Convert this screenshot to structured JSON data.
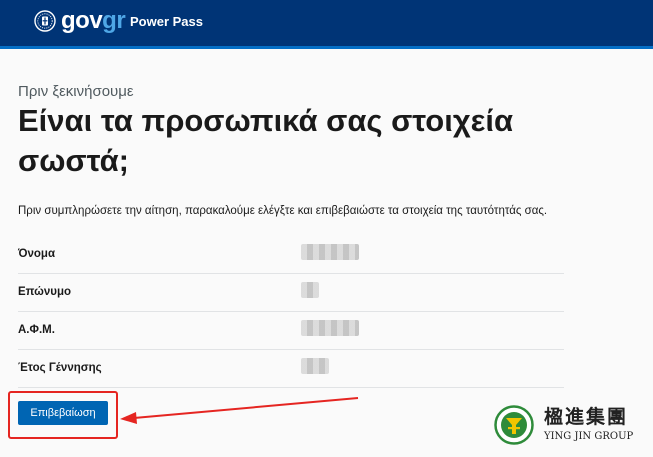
{
  "header": {
    "logo": {
      "gov": "gov",
      "gr": "gr",
      "emblem": "greek-emblem-icon"
    },
    "app_name": "Power Pass"
  },
  "page": {
    "overline": "Πριν ξεκινήσουμε",
    "title": "Είναι τα προσωπικά σας στοιχεία σωστά;",
    "intro": "Πριν συμπληρώσετε την αίτηση, παρακαλούμε ελέγξτε και επιβεβαιώστε τα στοιχεία της ταυτότητάς σας."
  },
  "details": [
    {
      "label": "Όνομα",
      "value_obscured": true
    },
    {
      "label": "Επώνυμο",
      "value_obscured": true
    },
    {
      "label": "Α.Φ.Μ.",
      "value_obscured": true
    },
    {
      "label": "Έτος Γέννησης",
      "value_obscured": true
    }
  ],
  "confirm_button": "Επιβεβαίωση",
  "annotation": {
    "color": "#e52521"
  },
  "watermark": {
    "chinese": "楹進集團",
    "english": "YING JIN GROUP"
  },
  "colors": {
    "header": "#003476",
    "accent": "#046ec5",
    "button": "#0065b3"
  }
}
